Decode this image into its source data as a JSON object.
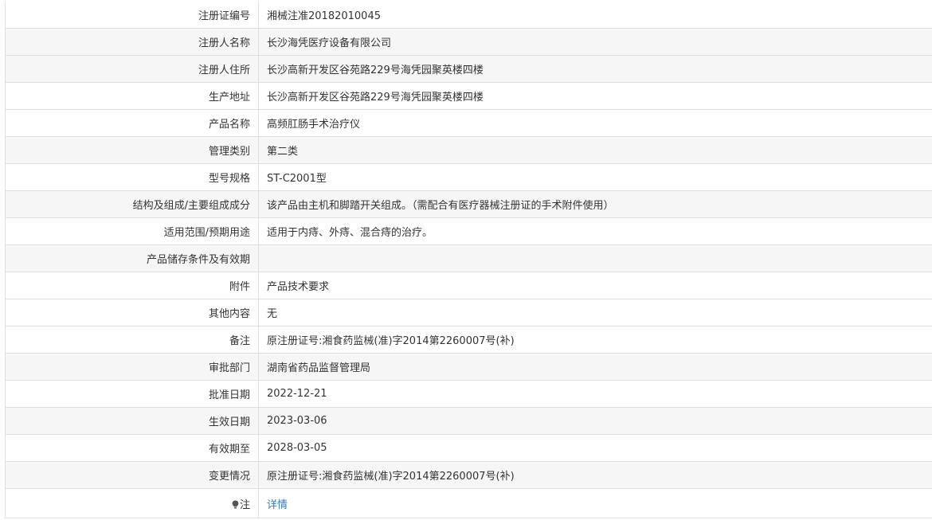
{
  "rows": [
    {
      "label": "注册证编号",
      "value": "湘械注准20182010045"
    },
    {
      "label": "注册人名称",
      "value": "长沙海凭医疗设备有限公司"
    },
    {
      "label": "注册人住所",
      "value": "长沙高新开发区谷苑路229号海凭园聚英楼四楼"
    },
    {
      "label": "生产地址",
      "value": "长沙高新开发区谷苑路229号海凭园聚英楼四楼"
    },
    {
      "label": "产品名称",
      "value": "高频肛肠手术治疗仪"
    },
    {
      "label": "管理类别",
      "value": "第二类"
    },
    {
      "label": "型号规格",
      "value": "ST-C2001型"
    },
    {
      "label": "结构及组成/主要组成成分",
      "value": "该产品由主机和脚踏开关组成。（需配合有医疗器械注册证的手术附件使用）"
    },
    {
      "label": "适用范围/预期用途",
      "value": "适用于内痔、外痔、混合痔的治疗。"
    },
    {
      "label": "产品储存条件及有效期",
      "value": ""
    },
    {
      "label": "附件",
      "value": "产品技术要求"
    },
    {
      "label": "其他内容",
      "value": "无"
    },
    {
      "label": "备注",
      "value": "原注册证号:湘食药监械(准)字2014第2260007号(补)"
    },
    {
      "label": "审批部门",
      "value": "湖南省药品监督管理局"
    },
    {
      "label": "批准日期",
      "value": "2022-12-21"
    },
    {
      "label": "生效日期",
      "value": "2023-03-06"
    },
    {
      "label": "有效期至",
      "value": "2028-03-05"
    },
    {
      "label": "变更情况",
      "value": "原注册证号:湘食药监械(准)字2014第2260007号(补)"
    }
  ],
  "note_row": {
    "icon": "bulb-icon",
    "label": "注",
    "link_text": "详情",
    "link_color": "#2a7ac7"
  }
}
